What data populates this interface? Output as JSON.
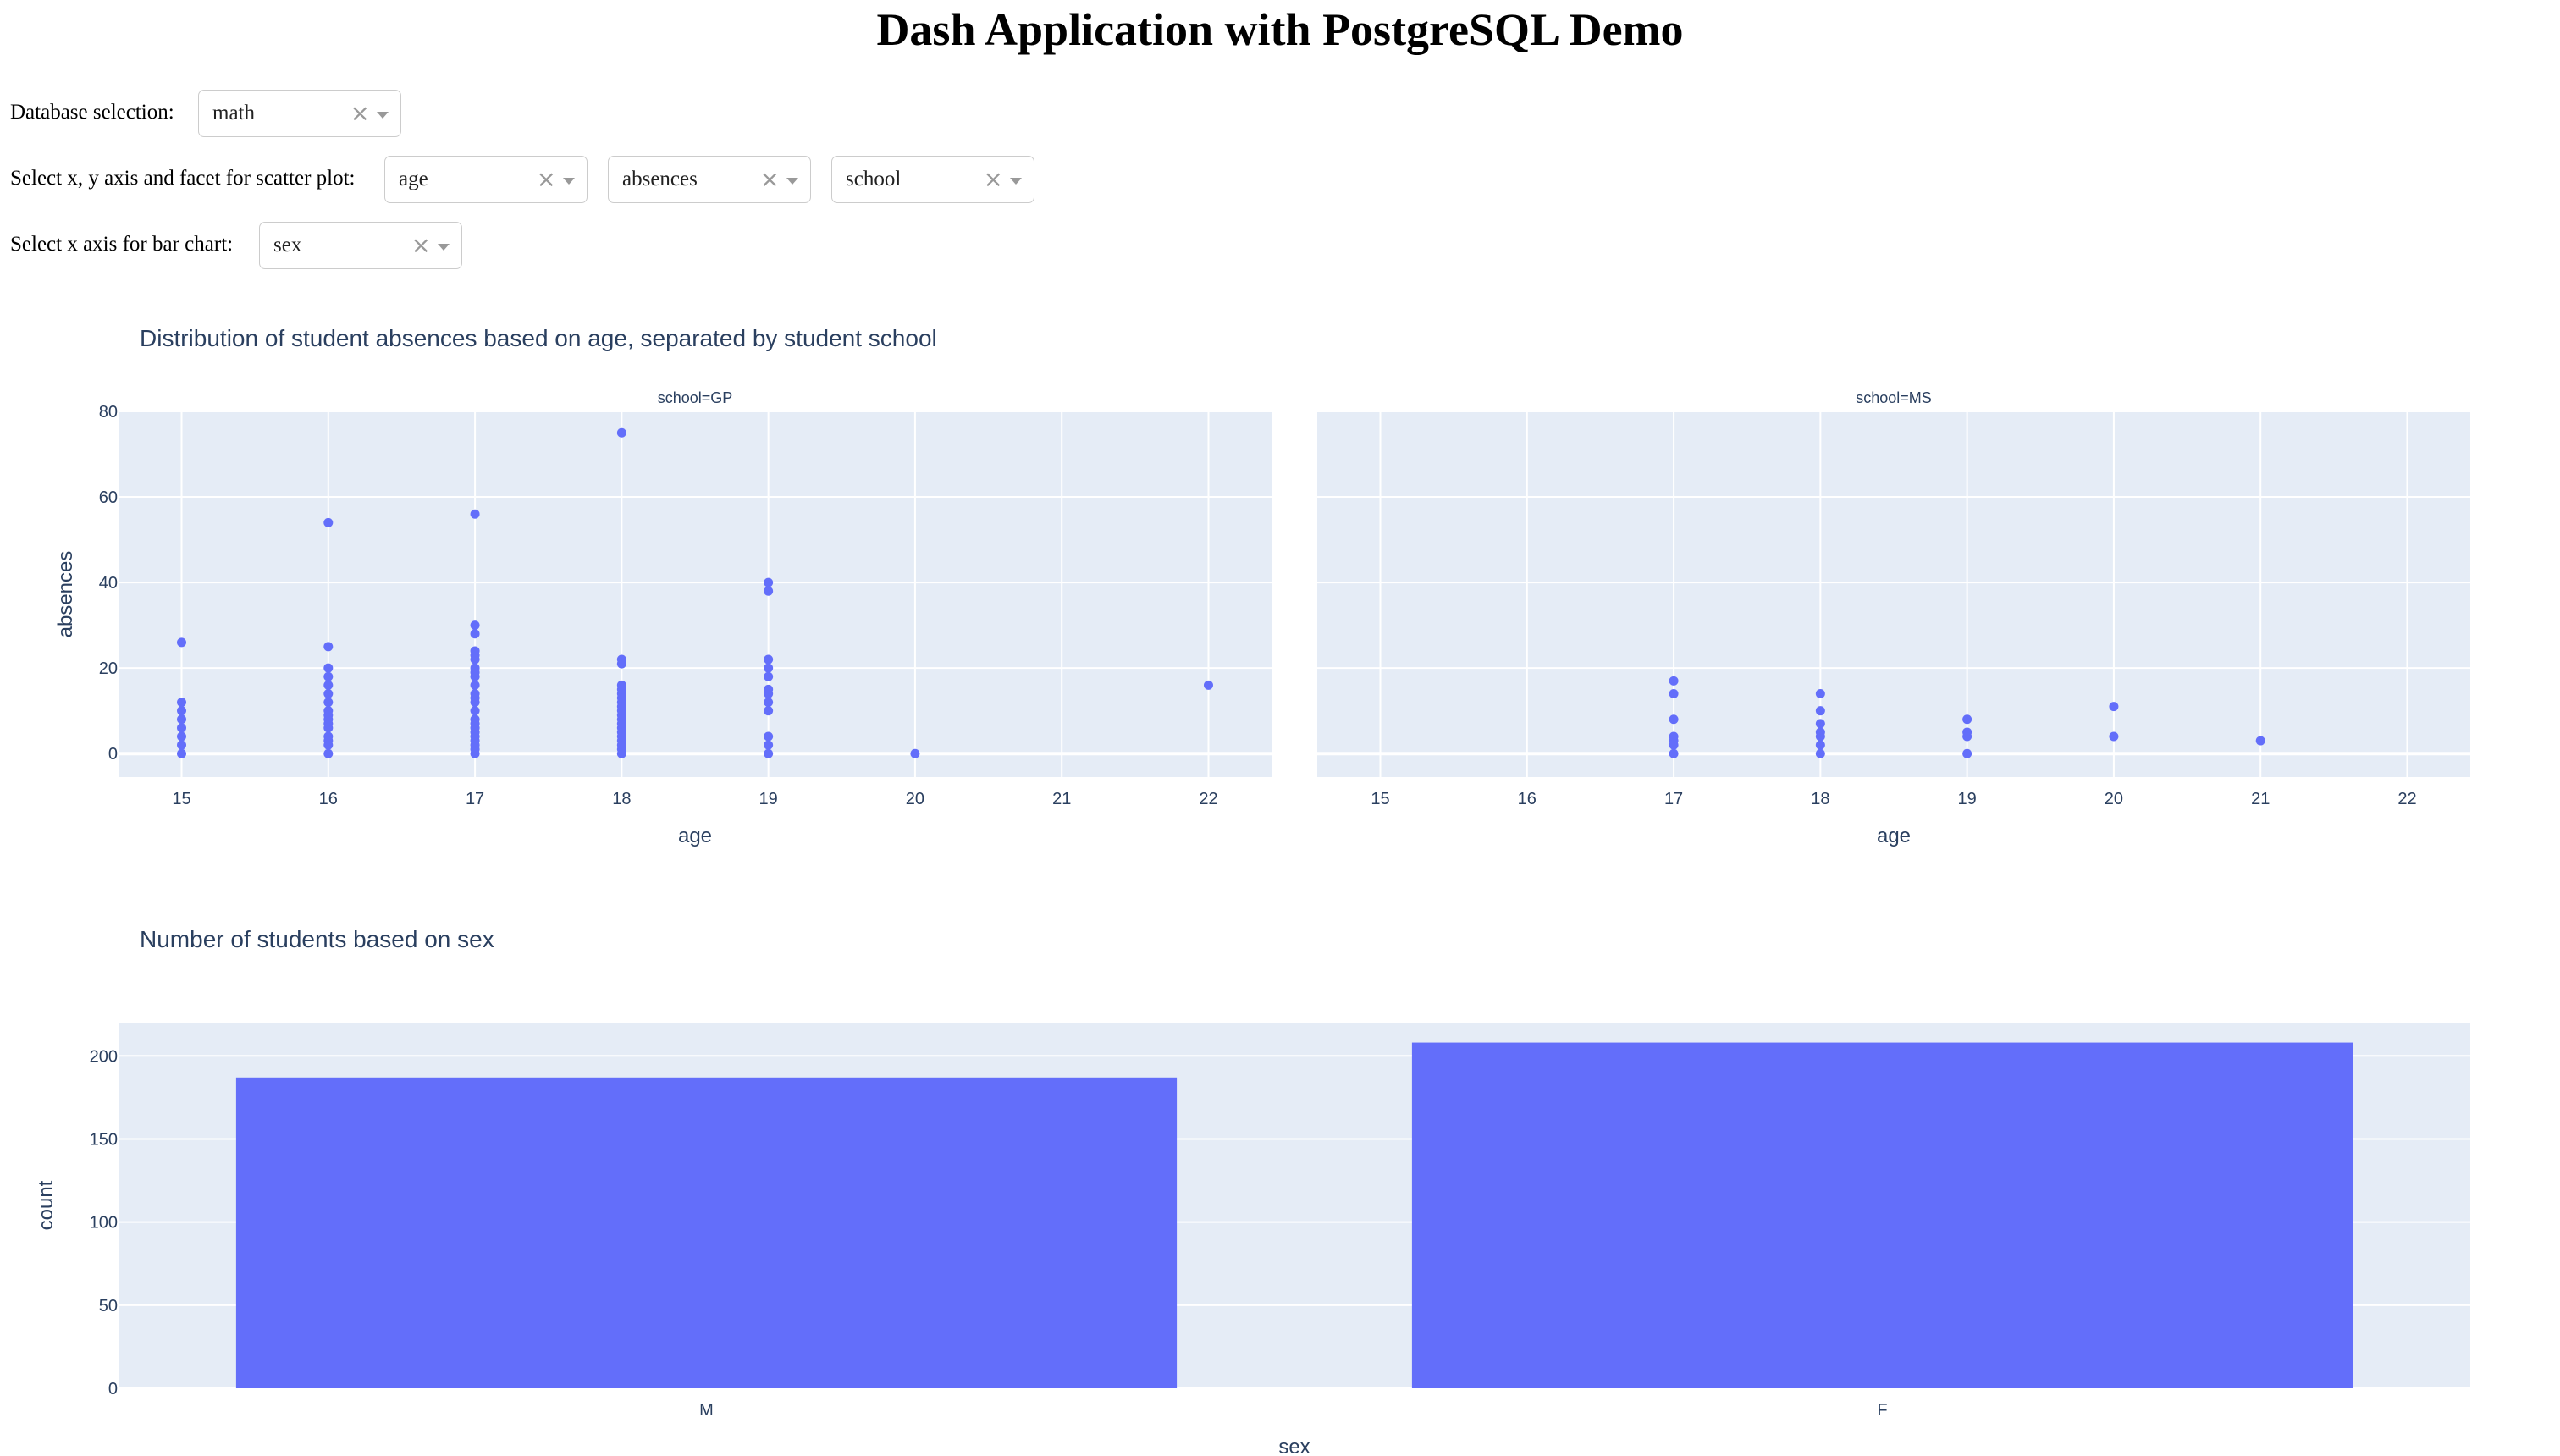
{
  "title": "Dash Application with PostgreSQL Demo",
  "controls": {
    "database": {
      "label": "Database selection:",
      "value": "math"
    },
    "scatter": {
      "label": "Select x, y axis and facet for scatter plot:",
      "x_value": "age",
      "y_value": "absences",
      "facet_value": "school"
    },
    "bar": {
      "label": "Select x axis for bar chart:",
      "value": "sex"
    },
    "clear_icon": "close-icon",
    "arrow_icon": "chevron-down-icon"
  },
  "colors": {
    "plot_bg": "#E5ECF6",
    "grid": "#ffffff",
    "marker": "#636EFA",
    "axis_text": "#2a3f5f"
  },
  "chart_data": [
    {
      "type": "scatter",
      "title": "Distribution of student absences based on age, separated by student school",
      "xlabel": "age",
      "ylabel": "absences",
      "xlim": [
        14.57,
        22.43
      ],
      "ylim": [
        -5.5,
        80
      ],
      "xticks": [
        15,
        16,
        17,
        18,
        19,
        20,
        21,
        22
      ],
      "yticks": [
        0,
        20,
        40,
        60,
        80
      ],
      "grid": true,
      "facets": [
        {
          "label": "school=GP",
          "points": [
            [
              15,
              0
            ],
            [
              15,
              2
            ],
            [
              15,
              4
            ],
            [
              15,
              6
            ],
            [
              15,
              8
            ],
            [
              15,
              10
            ],
            [
              15,
              12
            ],
            [
              15,
              26
            ],
            [
              16,
              0
            ],
            [
              16,
              2
            ],
            [
              16,
              3
            ],
            [
              16,
              4
            ],
            [
              16,
              6
            ],
            [
              16,
              7
            ],
            [
              16,
              8
            ],
            [
              16,
              9
            ],
            [
              16,
              10
            ],
            [
              16,
              12
            ],
            [
              16,
              14
            ],
            [
              16,
              16
            ],
            [
              16,
              18
            ],
            [
              16,
              20
            ],
            [
              16,
              25
            ],
            [
              16,
              54
            ],
            [
              17,
              0
            ],
            [
              17,
              1
            ],
            [
              17,
              2
            ],
            [
              17,
              3
            ],
            [
              17,
              4
            ],
            [
              17,
              5
            ],
            [
              17,
              6
            ],
            [
              17,
              7
            ],
            [
              17,
              8
            ],
            [
              17,
              10
            ],
            [
              17,
              12
            ],
            [
              17,
              13
            ],
            [
              17,
              14
            ],
            [
              17,
              16
            ],
            [
              17,
              18
            ],
            [
              17,
              19
            ],
            [
              17,
              20
            ],
            [
              17,
              22
            ],
            [
              17,
              23
            ],
            [
              17,
              24
            ],
            [
              17,
              28
            ],
            [
              17,
              30
            ],
            [
              17,
              56
            ],
            [
              18,
              0
            ],
            [
              18,
              1
            ],
            [
              18,
              2
            ],
            [
              18,
              3
            ],
            [
              18,
              4
            ],
            [
              18,
              5
            ],
            [
              18,
              6
            ],
            [
              18,
              7
            ],
            [
              18,
              8
            ],
            [
              18,
              9
            ],
            [
              18,
              10
            ],
            [
              18,
              11
            ],
            [
              18,
              12
            ],
            [
              18,
              13
            ],
            [
              18,
              14
            ],
            [
              18,
              15
            ],
            [
              18,
              16
            ],
            [
              18,
              21
            ],
            [
              18,
              22
            ],
            [
              18,
              75
            ],
            [
              19,
              0
            ],
            [
              19,
              2
            ],
            [
              19,
              4
            ],
            [
              19,
              10
            ],
            [
              19,
              12
            ],
            [
              19,
              14
            ],
            [
              19,
              15
            ],
            [
              19,
              18
            ],
            [
              19,
              20
            ],
            [
              19,
              22
            ],
            [
              19,
              38
            ],
            [
              19,
              40
            ],
            [
              20,
              0
            ],
            [
              22,
              16
            ]
          ]
        },
        {
          "label": "school=MS",
          "points": [
            [
              17,
              0
            ],
            [
              17,
              2
            ],
            [
              17,
              3
            ],
            [
              17,
              4
            ],
            [
              17,
              8
            ],
            [
              17,
              14
            ],
            [
              17,
              17
            ],
            [
              18,
              0
            ],
            [
              18,
              2
            ],
            [
              18,
              4
            ],
            [
              18,
              5
            ],
            [
              18,
              7
            ],
            [
              18,
              10
            ],
            [
              18,
              14
            ],
            [
              19,
              0
            ],
            [
              19,
              4
            ],
            [
              19,
              5
            ],
            [
              19,
              8
            ],
            [
              20,
              4
            ],
            [
              20,
              11
            ],
            [
              21,
              3
            ]
          ]
        }
      ]
    },
    {
      "type": "bar",
      "title": "Number of students based on sex",
      "xlabel": "sex",
      "ylabel": "count",
      "categories": [
        "M",
        "F"
      ],
      "values": [
        187,
        208
      ],
      "ylim": [
        0,
        220
      ],
      "yticks": [
        0,
        50,
        100,
        150,
        200
      ],
      "grid": true
    }
  ]
}
